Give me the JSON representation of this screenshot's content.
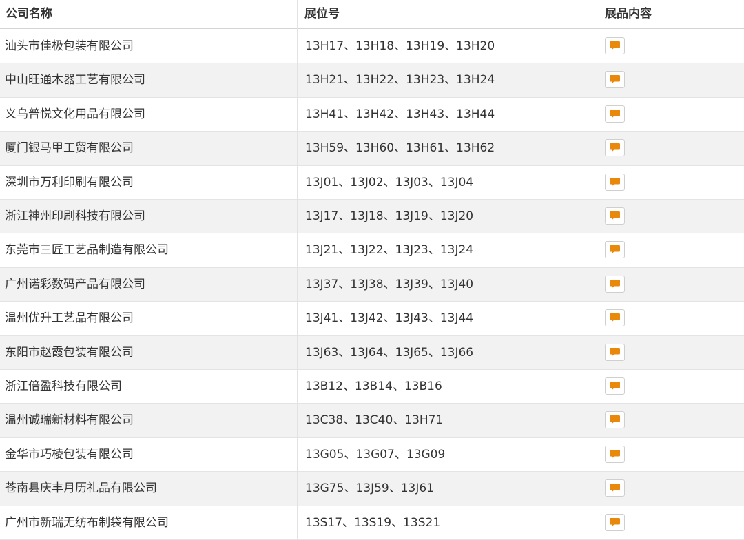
{
  "header": {
    "company_label": "公司名称",
    "booth_label": "展位号",
    "content_label": "展品内容"
  },
  "rows": [
    {
      "company": "汕头市佳极包装有限公司",
      "booth": "13H17、13H18、13H19、13H20",
      "icon": "comment-icon"
    },
    {
      "company": "中山旺通木器工艺有限公司",
      "booth": "13H21、13H22、13H23、13H24",
      "icon": "comment-icon"
    },
    {
      "company": "义乌普悦文化用品有限公司",
      "booth": "13H41、13H42、13H43、13H44",
      "icon": "comment-icon"
    },
    {
      "company": "厦门银马甲工贸有限公司",
      "booth": "13H59、13H60、13H61、13H62",
      "icon": "comment-icon"
    },
    {
      "company": "深圳市万利印刷有限公司",
      "booth": "13J01、13J02、13J03、13J04",
      "icon": "comment-icon"
    },
    {
      "company": "浙江神州印刷科技有限公司",
      "booth": "13J17、13J18、13J19、13J20",
      "icon": "comment-icon"
    },
    {
      "company": "东莞市三匠工艺品制造有限公司",
      "booth": "13J21、13J22、13J23、13J24",
      "icon": "comment-icon"
    },
    {
      "company": "广州诺彩数码产品有限公司",
      "booth": "13J37、13J38、13J39、13J40",
      "icon": "comment-icon"
    },
    {
      "company": "温州优升工艺品有限公司",
      "booth": "13J41、13J42、13J43、13J44",
      "icon": "comment-icon"
    },
    {
      "company": "东阳市赵霞包装有限公司",
      "booth": "13J63、13J64、13J65、13J66",
      "icon": "comment-icon"
    },
    {
      "company": "浙江倍盈科技有限公司",
      "booth": "13B12、13B14、13B16",
      "icon": "comment-icon"
    },
    {
      "company": "温州诚瑞新材料有限公司",
      "booth": "13C38、13C40、13H71",
      "icon": "comment-icon"
    },
    {
      "company": "金华市巧棱包装有限公司",
      "booth": "13G05、13G07、13G09",
      "icon": "comment-icon"
    },
    {
      "company": "苍南县庆丰月历礼品有限公司",
      "booth": "13G75、13J59、13J61",
      "icon": "comment-icon"
    },
    {
      "company": "广州市新瑞无纺布制袋有限公司",
      "booth": "13S17、13S19、13S21",
      "icon": "comment-icon"
    }
  ],
  "colors": {
    "icon_accent": "#e8890c",
    "alt_row": "#f2f2f2",
    "border": "#e3e3e3"
  }
}
